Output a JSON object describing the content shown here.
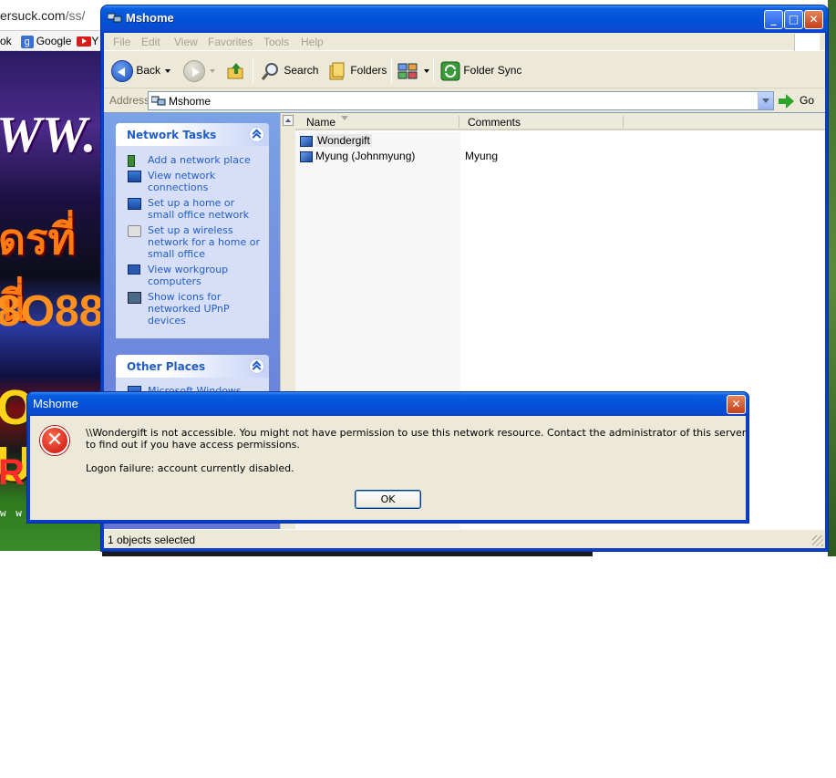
{
  "background": {
    "url_host": "ersuck.com",
    "url_path": "/ss/",
    "bookmarks": [
      "ok",
      "Google",
      "Y"
    ],
    "banner_lines": [
      "WW.",
      "ดรที่นี่",
      "8O88",
      "O US",
      "RE",
      "w w w . t"
    ]
  },
  "window": {
    "title": "Mshome",
    "controls": {
      "minimize": "_",
      "maximize": "□",
      "close": "✕"
    },
    "menu": [
      "File",
      "Edit",
      "View",
      "Favorites",
      "Tools",
      "Help"
    ],
    "toolbar": {
      "back": "Back",
      "search": "Search",
      "folders": "Folders",
      "folder_sync": "Folder Sync"
    },
    "address": {
      "label": "Address",
      "value": "Mshome",
      "go": "Go"
    },
    "network_tasks": {
      "title": "Network Tasks",
      "items": [
        "Add a network place",
        "View network connections",
        "Set up a home or small office network",
        "Set up a wireless network for a home or small office",
        "View workgroup computers",
        "Show icons for networked UPnP devices"
      ]
    },
    "other_places": {
      "title": "Other Places",
      "items": [
        "Microsoft Windows"
      ]
    },
    "columns": [
      "Name",
      "Comments"
    ],
    "rows": [
      {
        "name": "Wondergift",
        "comment": ""
      },
      {
        "name": "Myung (Johnmyung)",
        "comment": "Myung"
      }
    ],
    "status": "1 objects selected"
  },
  "dialog": {
    "title": "Mshome",
    "close": "✕",
    "icon": "✕",
    "message": "\\\\Wondergift is not accessible. You might not have permission to use this network resource. Contact the administrator of this server to find out if you have access permissions.",
    "detail": "Logon failure: account currently disabled.",
    "ok": "OK"
  }
}
